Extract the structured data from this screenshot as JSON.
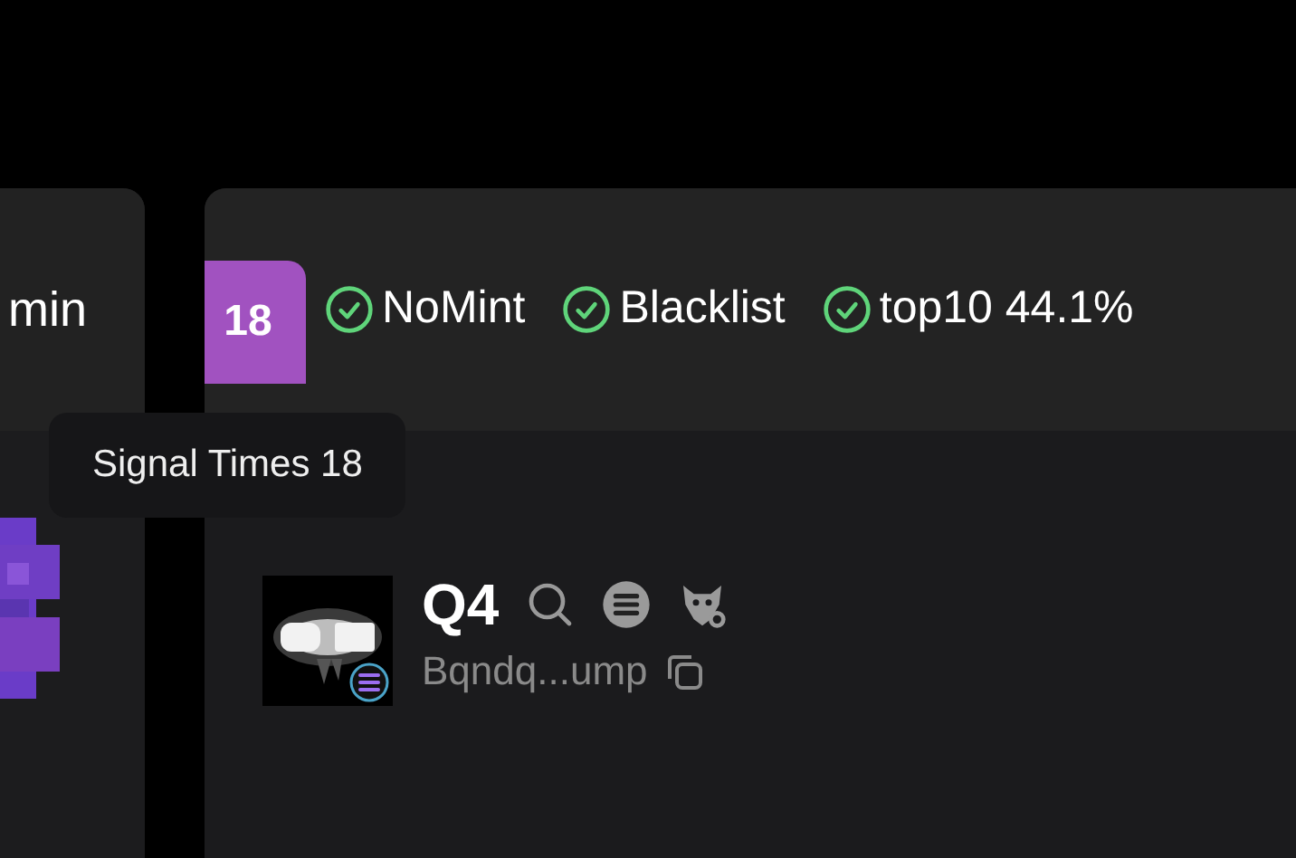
{
  "left_card": {
    "time": "min"
  },
  "signal_badge": {
    "count": "18",
    "tooltip": "Signal Times 18"
  },
  "checks": [
    {
      "label": "NoMint",
      "checked": true
    },
    {
      "label": "Blacklist",
      "checked": true
    },
    {
      "label": "top10 44.1%",
      "checked": true
    }
  ],
  "token": {
    "name": "Q4",
    "address": "Bqndq...ump"
  }
}
